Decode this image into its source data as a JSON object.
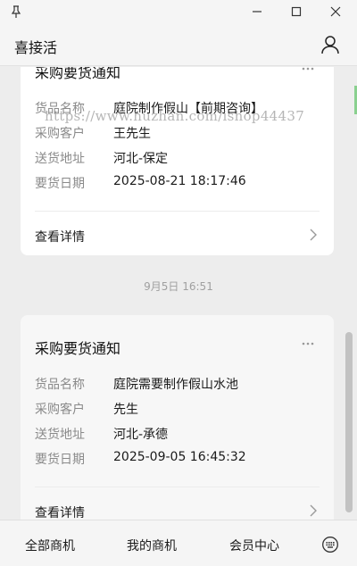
{
  "app": {
    "title": "喜接活"
  },
  "window": {
    "icons": [
      "pin-icon",
      "minimize-icon",
      "maximize-icon",
      "close-icon"
    ]
  },
  "watermark": "https://www.huzhan.com/ishop44437",
  "cards": [
    {
      "title": "采购要货通知",
      "fields": [
        {
          "label": "货品名称",
          "value": "庭院制作假山【前期咨询】"
        },
        {
          "label": "采购客户",
          "value": "王先生"
        },
        {
          "label": "送货地址",
          "value": "河北-保定"
        },
        {
          "label": "要货日期",
          "value": "2025-08-21 18:17:46"
        }
      ],
      "detail_label": "查看详情"
    },
    {
      "title": "采购要货通知",
      "fields": [
        {
          "label": "货品名称",
          "value": "庭院需要制作假山水池"
        },
        {
          "label": "采购客户",
          "value": "先生"
        },
        {
          "label": "送货地址",
          "value": "河北-承德"
        },
        {
          "label": "要货日期",
          "value": "2025-09-05 16:45:32"
        }
      ],
      "detail_label": "查看详情"
    }
  ],
  "timestamp": "9月5日 16:51",
  "footer": {
    "tabs": [
      "全部商机",
      "我的商机",
      "会员中心"
    ],
    "keyboard_icon": "keyboard-icon"
  },
  "colors": {
    "background": "#ededed",
    "card": "#ffffff",
    "label": "#8a8a8a"
  }
}
